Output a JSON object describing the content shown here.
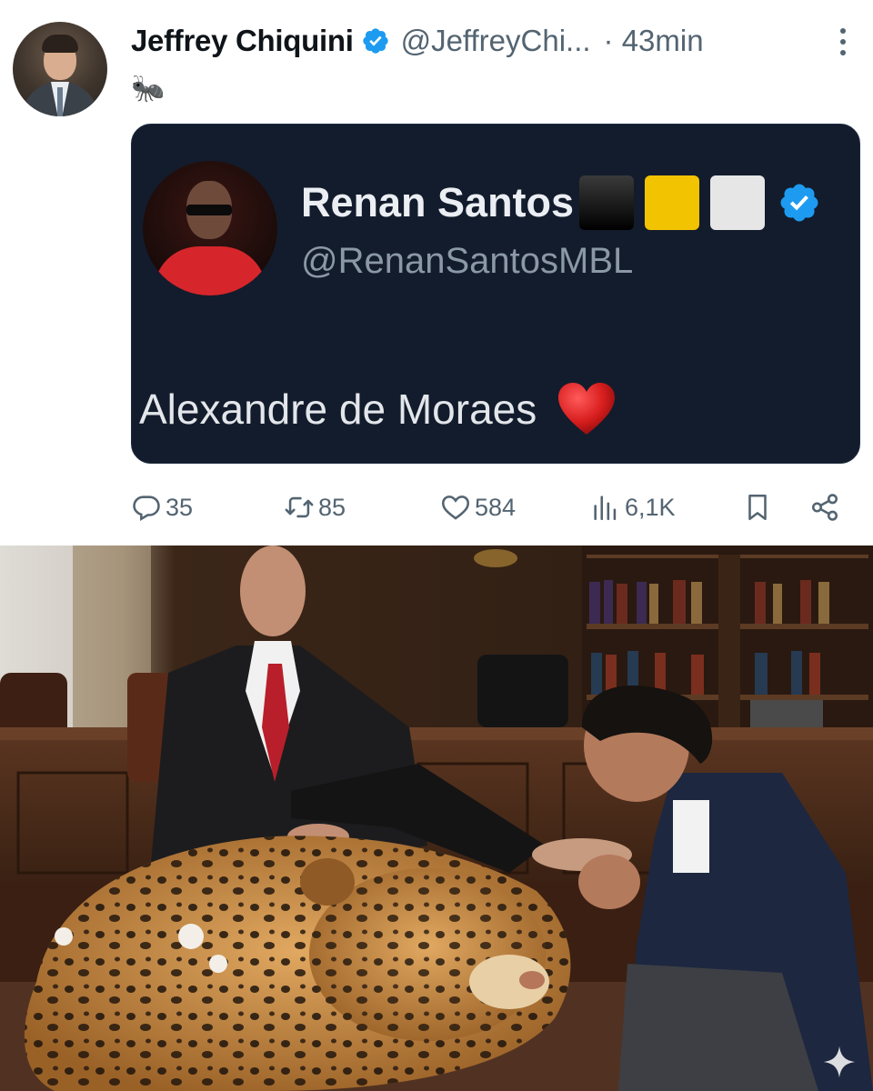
{
  "tweet": {
    "author_name": "Jeffrey Chiquini",
    "author_handle": "@JeffreyChi...",
    "time_ago": "· 43min",
    "text": "🐜"
  },
  "quoted_image": {
    "name": "Renan Santos",
    "handle": "@RenanSantosMBL",
    "text": "Alexandre de Moraes"
  },
  "actions": {
    "replies": "35",
    "reposts": "85",
    "likes": "584",
    "views": "6,1K"
  },
  "colors": {
    "verified_blue": "#1d9bf0",
    "card_background": "#131c2c",
    "action_gray": "#536471"
  },
  "icons": [
    "verified-icon",
    "more-icon",
    "reply-icon",
    "repost-icon",
    "like-icon",
    "views-icon",
    "bookmark-icon",
    "share-icon",
    "sparkle-icon"
  ]
}
